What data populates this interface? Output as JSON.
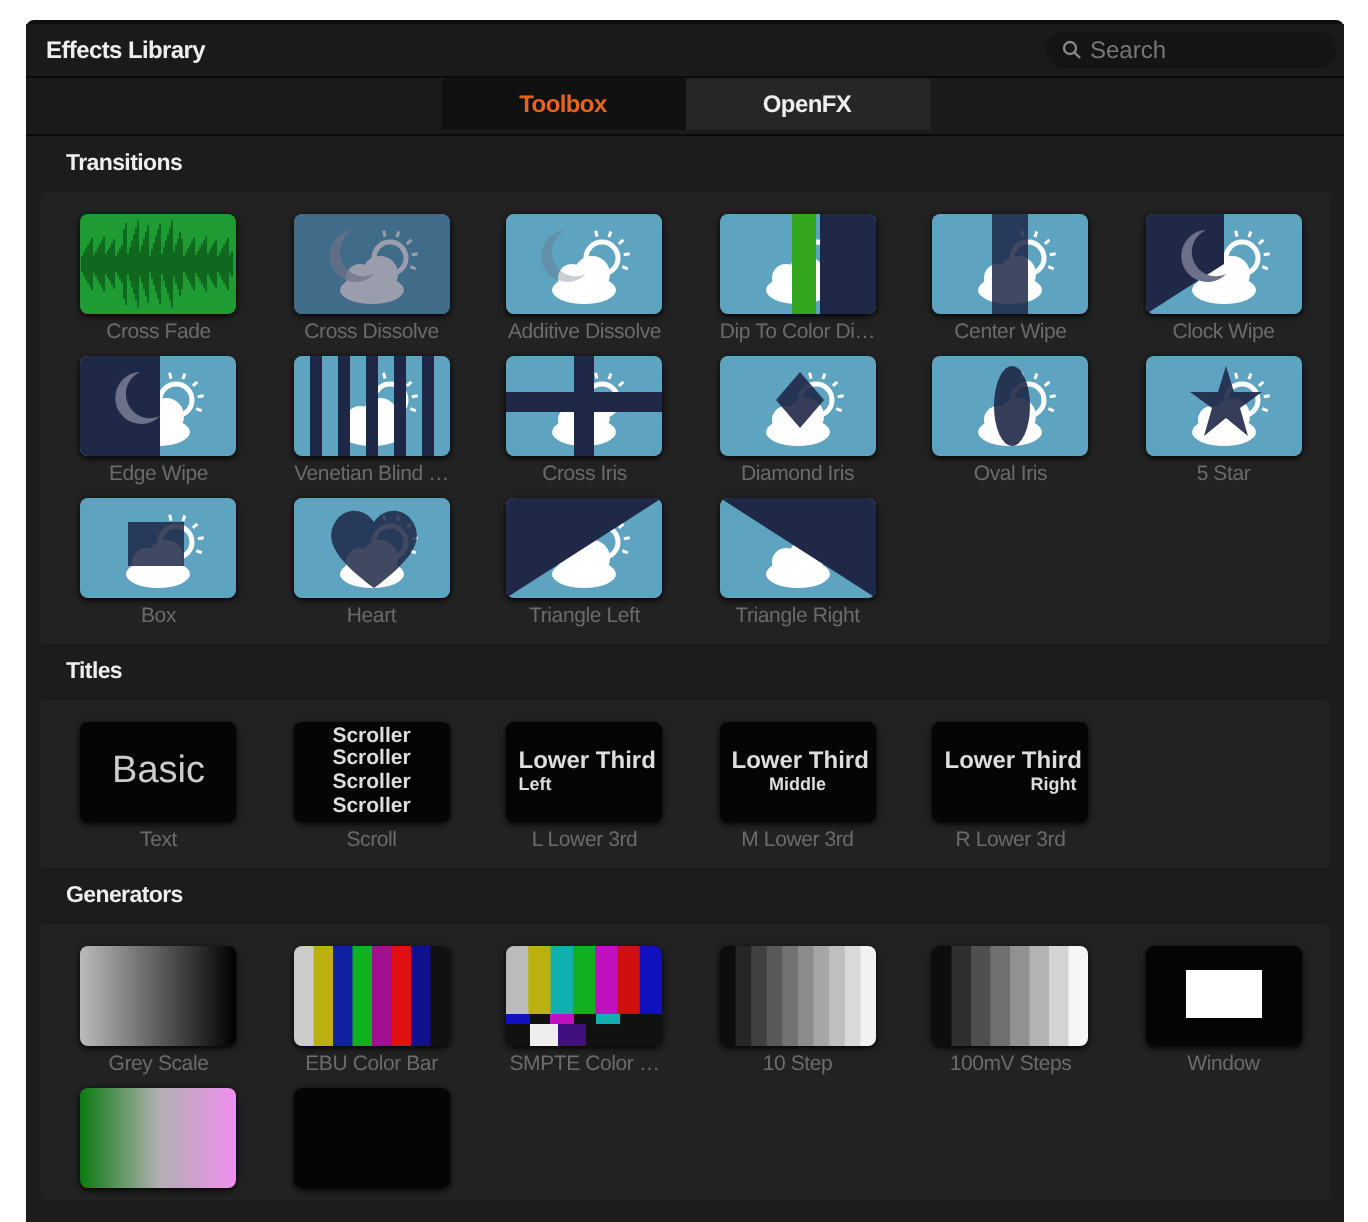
{
  "window": {
    "title": "Effects Library"
  },
  "search": {
    "placeholder": "Search"
  },
  "tabs": [
    {
      "label": "Toolbox",
      "selected": true
    },
    {
      "label": "OpenFX",
      "selected": false
    }
  ],
  "sections": [
    {
      "title": "Transitions",
      "kind": "transitions",
      "items": [
        {
          "label": "Cross Fade",
          "kind": "waveform"
        },
        {
          "label": "Cross Dissolve",
          "kind": "dissolve"
        },
        {
          "label": "Additive Dissolve",
          "kind": "additive"
        },
        {
          "label": "Dip To Color Di…",
          "kind": "dip"
        },
        {
          "label": "Center Wipe",
          "kind": "center"
        },
        {
          "label": "Clock Wipe",
          "kind": "clock"
        },
        {
          "label": "Edge Wipe",
          "kind": "edge"
        },
        {
          "label": "Venetian Blind …",
          "kind": "blind"
        },
        {
          "label": "Cross Iris",
          "kind": "cross"
        },
        {
          "label": "Diamond Iris",
          "kind": "diamond"
        },
        {
          "label": "Oval Iris",
          "kind": "oval"
        },
        {
          "label": "5 Star",
          "kind": "star"
        },
        {
          "label": "Box",
          "kind": "box"
        },
        {
          "label": "Heart",
          "kind": "heart"
        },
        {
          "label": "Triangle Left",
          "kind": "tri_left"
        },
        {
          "label": "Triangle Right",
          "kind": "tri_right"
        }
      ]
    },
    {
      "title": "Titles",
      "kind": "titles",
      "items": [
        {
          "label": "Text",
          "kind": "basic",
          "preview": [
            "Basic"
          ]
        },
        {
          "label": "Scroll",
          "kind": "scroll",
          "preview": [
            "Scroller",
            "Scroller",
            "Scroller",
            "Scroller"
          ]
        },
        {
          "label": "L Lower 3rd",
          "kind": "lower_left",
          "preview": [
            "Lower Third",
            "Left"
          ]
        },
        {
          "label": "M Lower 3rd",
          "kind": "lower_center",
          "preview": [
            "Lower Third",
            "Middle"
          ]
        },
        {
          "label": "R Lower 3rd",
          "kind": "lower_right",
          "preview": [
            "Lower Third",
            "Right"
          ]
        }
      ]
    },
    {
      "title": "Generators",
      "kind": "generators",
      "items": [
        {
          "label": "Grey Scale",
          "kind": "grey"
        },
        {
          "label": "EBU Color Bar",
          "kind": "ebu"
        },
        {
          "label": "SMPTE Color …",
          "kind": "smpte"
        },
        {
          "label": "10 Step",
          "kind": "steps10"
        },
        {
          "label": "100mV Steps",
          "kind": "steps"
        },
        {
          "label": "Window",
          "kind": "window"
        },
        {
          "kind": "four_color"
        },
        {
          "kind": "solid"
        }
      ]
    }
  ]
}
